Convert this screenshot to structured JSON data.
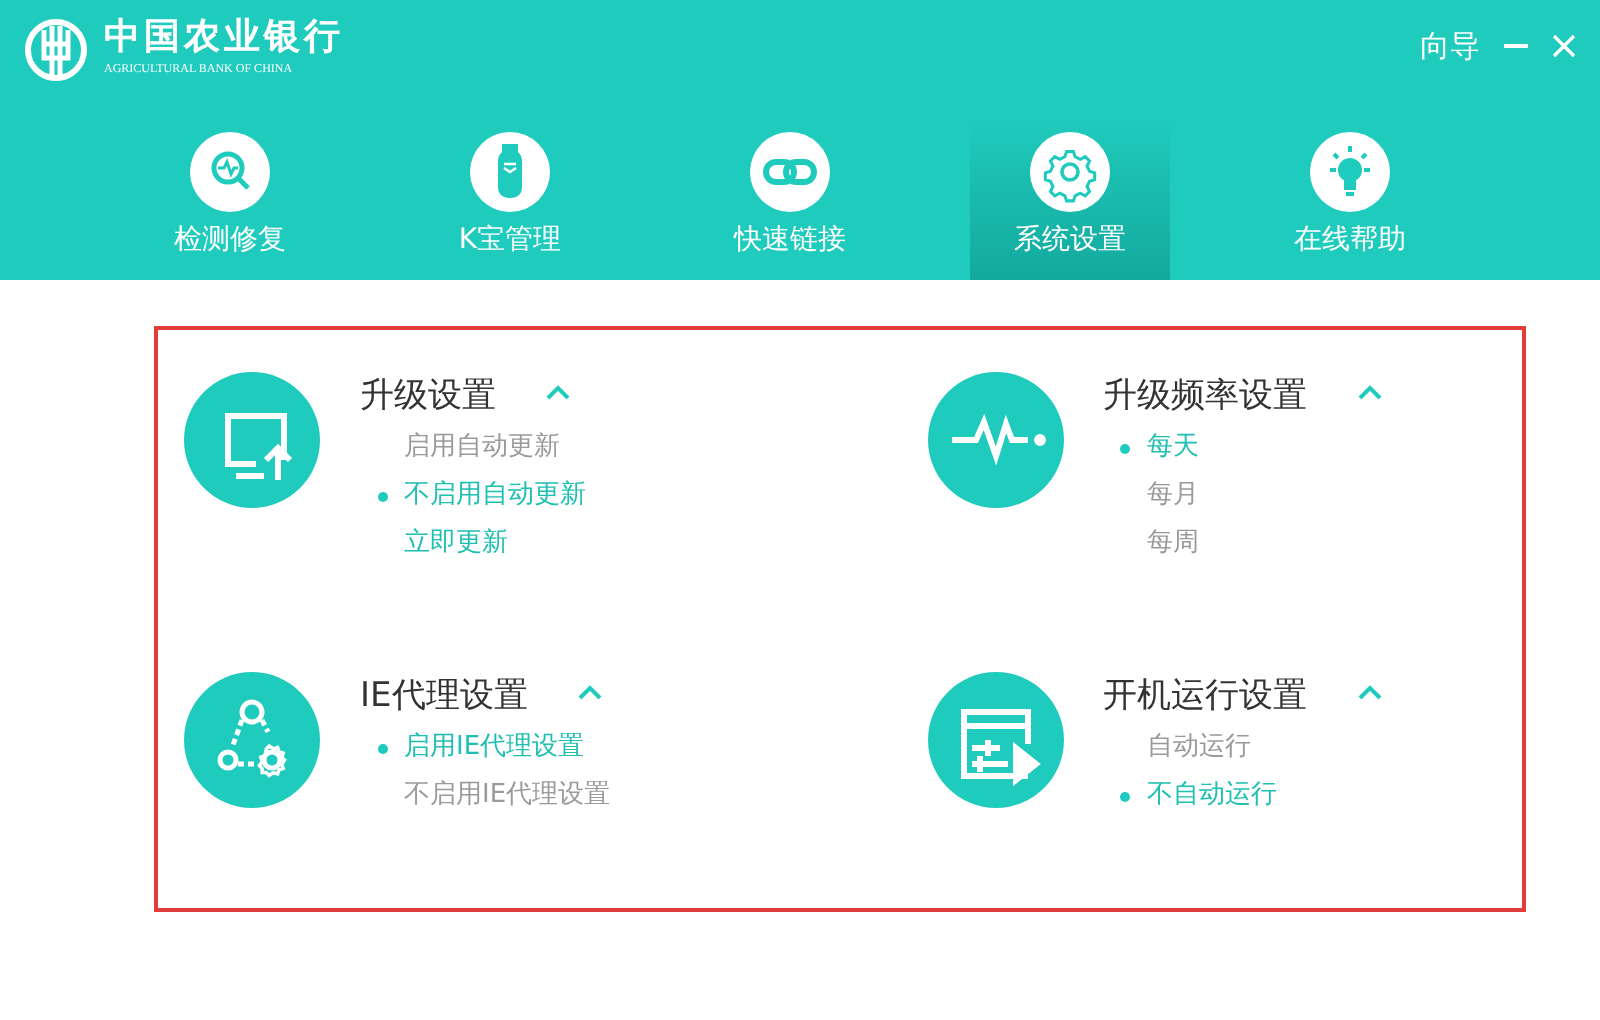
{
  "brand": {
    "name": "中国农业银行",
    "subtitle": "AGRICULTURAL BANK OF CHINA"
  },
  "window_controls": {
    "guide": "向导"
  },
  "tabs": [
    {
      "label": "检测修复",
      "kind": "scan",
      "selected": false
    },
    {
      "label": "K宝管理",
      "kind": "usb",
      "selected": false
    },
    {
      "label": "快速链接",
      "kind": "link",
      "selected": false
    },
    {
      "label": "系统设置",
      "kind": "gear",
      "selected": true
    },
    {
      "label": "在线帮助",
      "kind": "bulb",
      "selected": false
    }
  ],
  "sections": [
    {
      "title": "升级设置",
      "kind": "monitor",
      "expanded": true,
      "options": [
        {
          "kind": "option",
          "label": "启用自动更新",
          "selected": false
        },
        {
          "kind": "option",
          "label": "不启用自动更新",
          "selected": true
        },
        {
          "kind": "action",
          "label": "立即更新"
        }
      ]
    },
    {
      "title": "升级频率设置",
      "kind": "pulse",
      "expanded": true,
      "options": [
        {
          "kind": "option",
          "label": "每天",
          "selected": true
        },
        {
          "kind": "option",
          "label": "每月",
          "selected": false
        },
        {
          "kind": "option",
          "label": "每周",
          "selected": false
        }
      ]
    },
    {
      "title": "IE代理设置",
      "kind": "proxy",
      "expanded": true,
      "options": [
        {
          "kind": "option",
          "label": "启用IE代理设置",
          "selected": true
        },
        {
          "kind": "option",
          "label": "不启用IE代理设置",
          "selected": false
        }
      ]
    },
    {
      "title": "开机运行设置",
      "kind": "startup",
      "expanded": true,
      "options": [
        {
          "kind": "option",
          "label": "自动运行",
          "selected": false
        },
        {
          "kind": "option",
          "label": "不自动运行",
          "selected": true
        }
      ]
    }
  ]
}
